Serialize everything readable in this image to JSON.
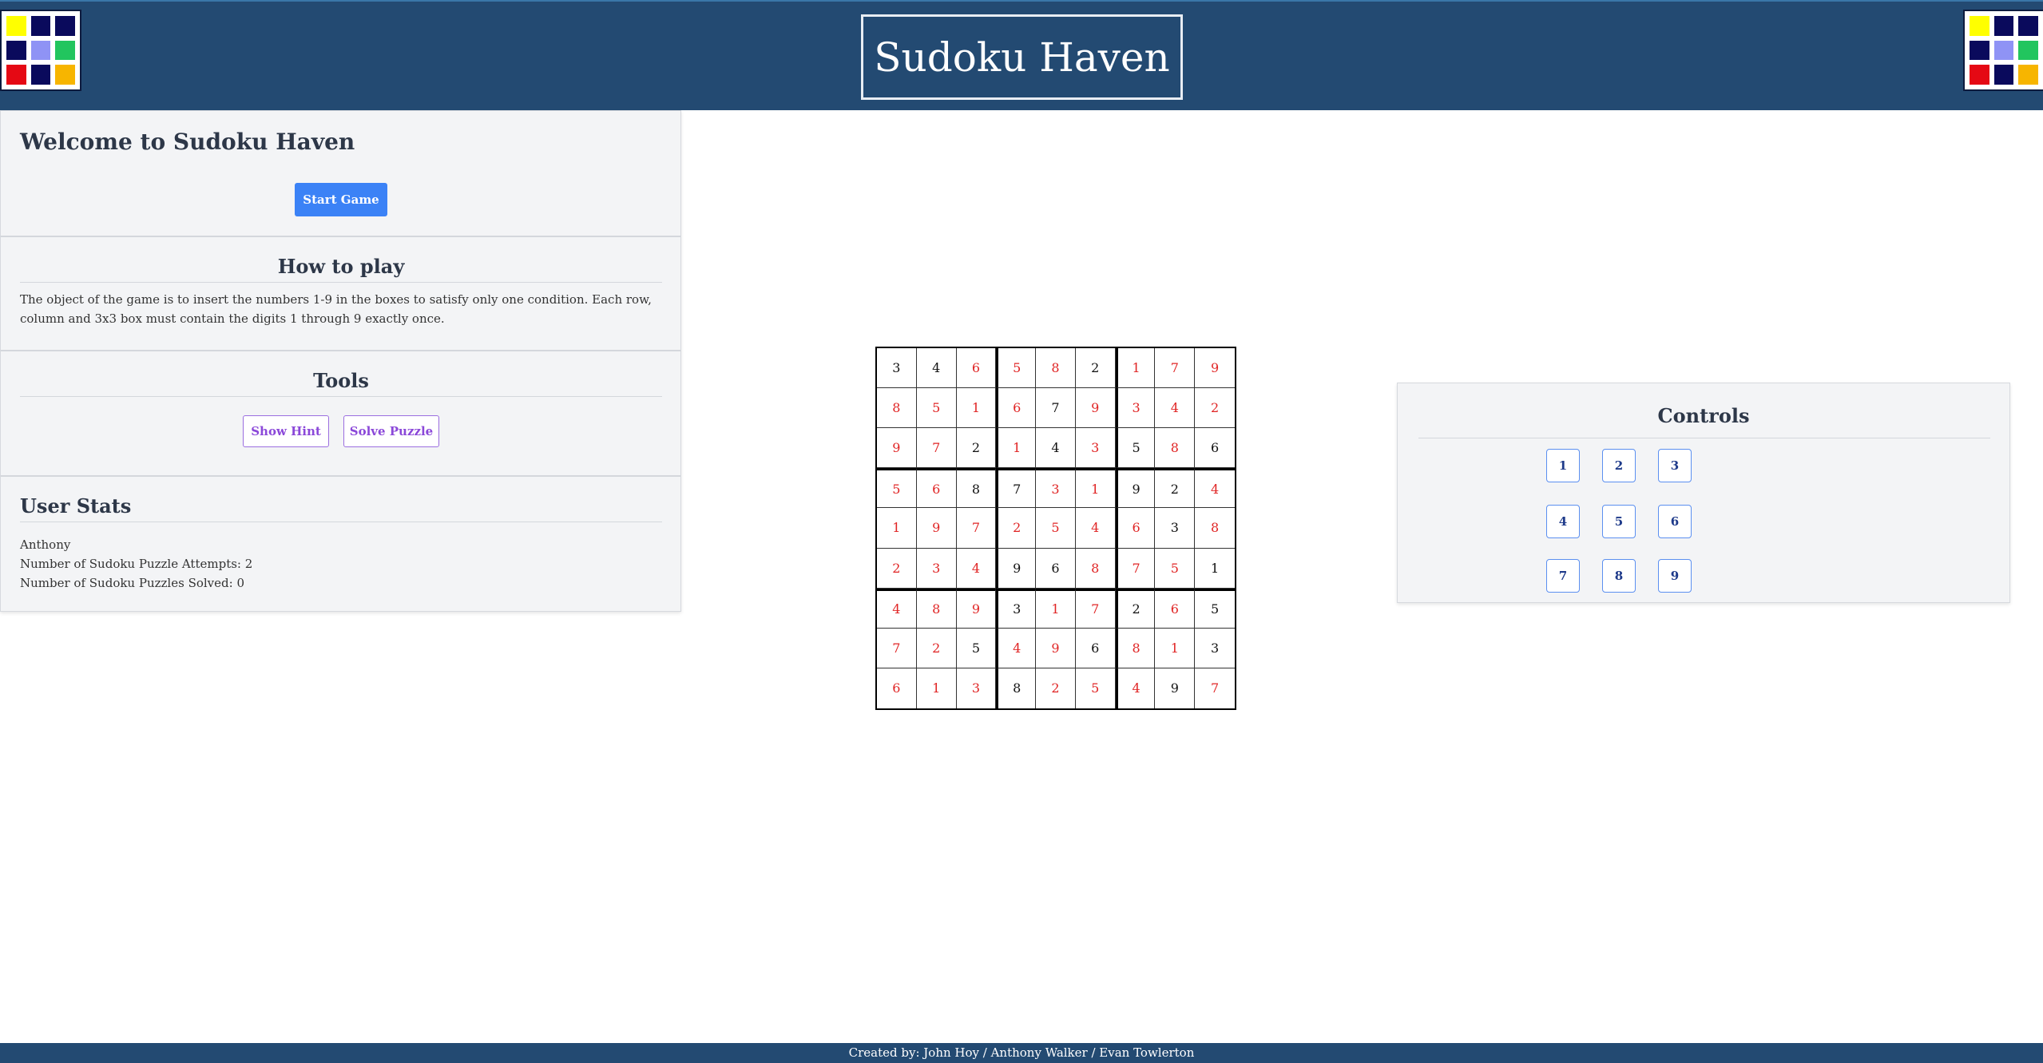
{
  "header": {
    "title": "Sudoku Haven",
    "logo_colors": [
      "#ffff00",
      "#0a0a5c",
      "#0a0a5c",
      "#0a0a5c",
      "#8f93f5",
      "#22c55e",
      "#e50914",
      "#0a0a5c",
      "#f7b500"
    ]
  },
  "welcome": {
    "heading": "Welcome to Sudoku Haven",
    "start_label": "Start Game"
  },
  "how_to_play": {
    "heading": "How to play",
    "text": "The object of the game is to insert the numbers 1-9 in the boxes to satisfy only one condition. Each row, column and 3x3 box must contain the digits 1 through 9 exactly once."
  },
  "tools": {
    "heading": "Tools",
    "hint_label": "Show Hint",
    "solve_label": "Solve Puzzle"
  },
  "user_stats": {
    "heading": "User Stats",
    "username": "Anthony",
    "attempts": "Number of Sudoku Puzzle Attempts: 2",
    "solved": "Number of Sudoku Puzzles Solved: 0"
  },
  "board": {
    "values": [
      [
        "3",
        "4",
        "6",
        "5",
        "8",
        "2",
        "1",
        "7",
        "9"
      ],
      [
        "8",
        "5",
        "1",
        "6",
        "7",
        "9",
        "3",
        "4",
        "2"
      ],
      [
        "9",
        "7",
        "2",
        "1",
        "4",
        "3",
        "5",
        "8",
        "6"
      ],
      [
        "5",
        "6",
        "8",
        "7",
        "3",
        "1",
        "9",
        "2",
        "4"
      ],
      [
        "1",
        "9",
        "7",
        "2",
        "5",
        "4",
        "6",
        "3",
        "8"
      ],
      [
        "2",
        "3",
        "4",
        "9",
        "6",
        "8",
        "7",
        "5",
        "1"
      ],
      [
        "4",
        "8",
        "9",
        "3",
        "1",
        "7",
        "2",
        "6",
        "5"
      ],
      [
        "7",
        "2",
        "5",
        "4",
        "9",
        "6",
        "8",
        "1",
        "3"
      ],
      [
        "6",
        "1",
        "3",
        "8",
        "2",
        "5",
        "4",
        "9",
        "7"
      ]
    ],
    "kind": [
      [
        "g",
        "g",
        "u",
        "u",
        "u",
        "g",
        "u",
        "u",
        "u"
      ],
      [
        "u",
        "u",
        "u",
        "u",
        "g",
        "u",
        "u",
        "u",
        "u"
      ],
      [
        "u",
        "u",
        "g",
        "u",
        "g",
        "u",
        "g",
        "u",
        "g"
      ],
      [
        "u",
        "u",
        "g",
        "g",
        "u",
        "u",
        "g",
        "g",
        "u"
      ],
      [
        "u",
        "u",
        "u",
        "u",
        "u",
        "u",
        "u",
        "g",
        "u"
      ],
      [
        "u",
        "u",
        "u",
        "g",
        "g",
        "u",
        "u",
        "u",
        "g"
      ],
      [
        "u",
        "u",
        "u",
        "g",
        "u",
        "u",
        "g",
        "u",
        "g"
      ],
      [
        "u",
        "u",
        "g",
        "u",
        "u",
        "g",
        "u",
        "u",
        "g"
      ],
      [
        "u",
        "u",
        "u",
        "g",
        "u",
        "u",
        "u",
        "g",
        "u"
      ]
    ],
    "colors": {
      "given": "#111111",
      "user": "#e02424"
    }
  },
  "controls": {
    "title": "Controls",
    "numbers": [
      "1",
      "2",
      "3",
      "4",
      "5",
      "6",
      "7",
      "8",
      "9"
    ]
  },
  "footer": {
    "credits": "Created by: John Hoy / Anthony Walker / Evan Towlerton"
  }
}
